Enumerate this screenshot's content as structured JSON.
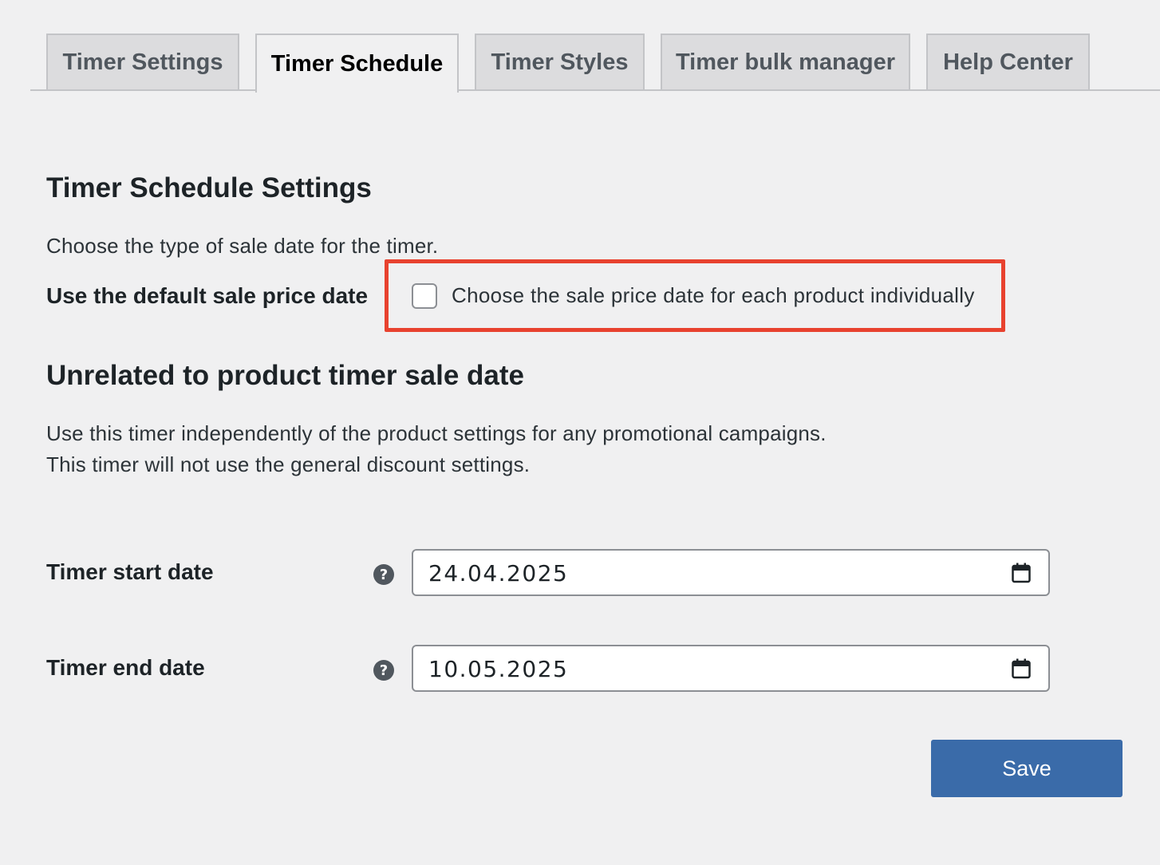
{
  "tabs": [
    {
      "label": "Timer Settings",
      "active": false
    },
    {
      "label": "Timer Schedule",
      "active": true
    },
    {
      "label": "Timer Styles",
      "active": false
    },
    {
      "label": "Timer bulk manager",
      "active": false
    },
    {
      "label": "Help Center",
      "active": false
    }
  ],
  "schedule": {
    "title": "Timer Schedule Settings",
    "description": "Choose the type of sale date for the timer.",
    "default_label": "Use the default sale price date",
    "checkbox_label": "Choose the sale price date for each product individually",
    "checkbox_checked": false
  },
  "unrelated": {
    "title": "Unrelated to product timer sale date",
    "line1": "Use this timer independently of the product settings for any promotional campaigns.",
    "line2": "This timer will not use the general discount settings."
  },
  "fields": {
    "start": {
      "label": "Timer start date",
      "value": "24.04.2025",
      "help_icon": "question-circle-icon"
    },
    "end": {
      "label": "Timer end date",
      "value": "10.05.2025",
      "help_icon": "question-circle-icon"
    }
  },
  "save_label": "Save",
  "colors": {
    "accent": "#3a6ba9",
    "highlight": "#e8422f",
    "background": "#f0f0f1"
  }
}
